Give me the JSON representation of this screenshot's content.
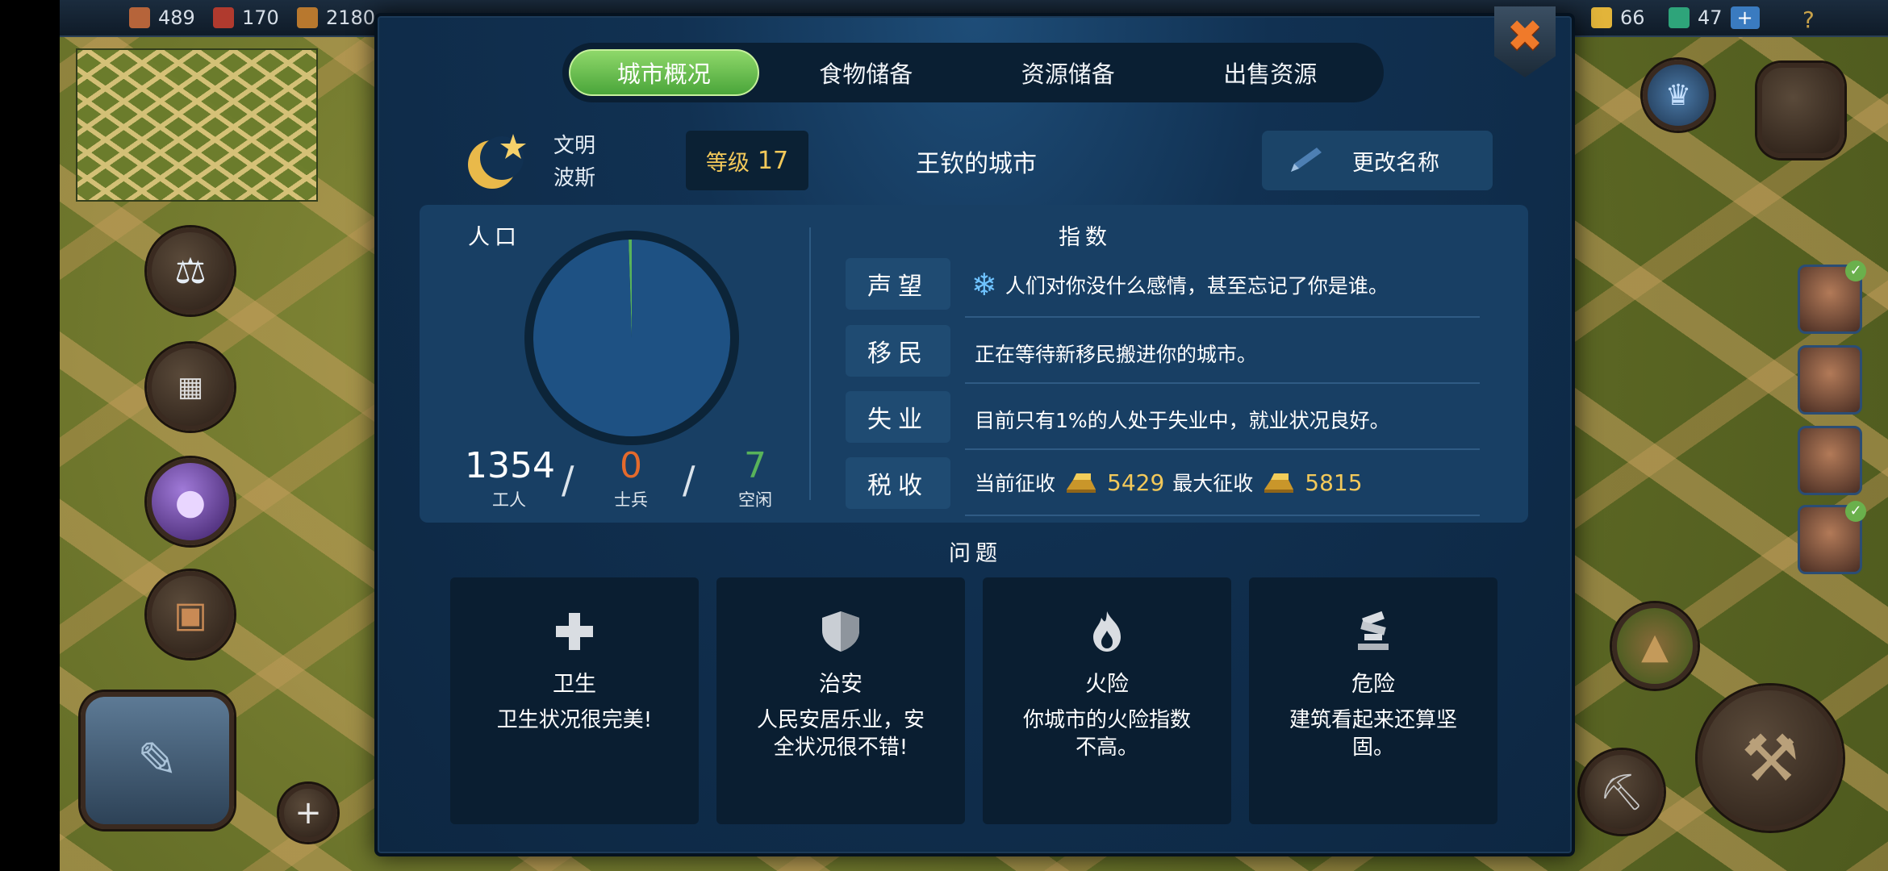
{
  "hud": {
    "resources": [
      {
        "name": "wood-cube",
        "value": "489",
        "color": "#b6643a"
      },
      {
        "name": "brick",
        "value": "170",
        "color": "#b03a2e"
      },
      {
        "name": "planks",
        "value": "2180",
        "color": "#b8782e"
      }
    ],
    "right_resources": [
      {
        "name": "gold-bars",
        "value": "66",
        "color": "#e2b43a"
      },
      {
        "name": "emerald",
        "value": "47",
        "color": "#2ea47a"
      }
    ],
    "plus": "+",
    "help": "?"
  },
  "tabs": [
    {
      "label": "城市概况",
      "active": true
    },
    {
      "label": "食物储备",
      "active": false
    },
    {
      "label": "资源储备",
      "active": false
    },
    {
      "label": "出售资源",
      "active": false
    }
  ],
  "close_glyph": "✖",
  "civilization": {
    "label": "文明",
    "name": "波斯",
    "level_label": "等级",
    "level": "17",
    "city_name": "王钦的城市",
    "rename_label": "更改名称"
  },
  "population": {
    "title": "人口",
    "workers": "1354",
    "workers_label": "工人",
    "soldiers": "0",
    "soldiers_label": "士兵",
    "idle": "7",
    "idle_label": "空闲",
    "separator": "/"
  },
  "chart_data": {
    "type": "pie",
    "categories": [
      "工人",
      "士兵",
      "空闲"
    ],
    "values": [
      1354,
      0,
      7
    ],
    "colors": [
      "#1e5183",
      "#e46a2c",
      "#58b35a"
    ]
  },
  "indices": {
    "title": "指数",
    "rows": [
      {
        "label": "声望",
        "text": "人们对你没什么感情，甚至忘记了你是谁。",
        "icon": "snowflake-icon"
      },
      {
        "label": "移民",
        "text": "正在等待新移民搬进你的城市。"
      },
      {
        "label": "失业",
        "text": "目前只有1%的人处于失业中，就业状况良好。"
      },
      {
        "label": "税收",
        "current_label": "当前征收",
        "current_value": "5429",
        "max_label": "最大征收",
        "max_value": "5815"
      }
    ]
  },
  "problems": {
    "title": "问题",
    "cards": [
      {
        "title": "卫生",
        "desc": "卫生状况很完美!",
        "icon": "health-cross-icon"
      },
      {
        "title": "治安",
        "desc": "人民安居乐业，安全状况很不错!",
        "icon": "shield-icon"
      },
      {
        "title": "火险",
        "desc": "你城市的火险指数不高。",
        "icon": "fire-icon"
      },
      {
        "title": "危险",
        "desc": "建筑看起来还算坚固。",
        "icon": "collapse-icon"
      }
    ]
  },
  "colors": {
    "accent_green": "#6cc24a",
    "gold": "#f3c95a",
    "soldiers": "#e46a2c",
    "idle": "#58b35a"
  }
}
